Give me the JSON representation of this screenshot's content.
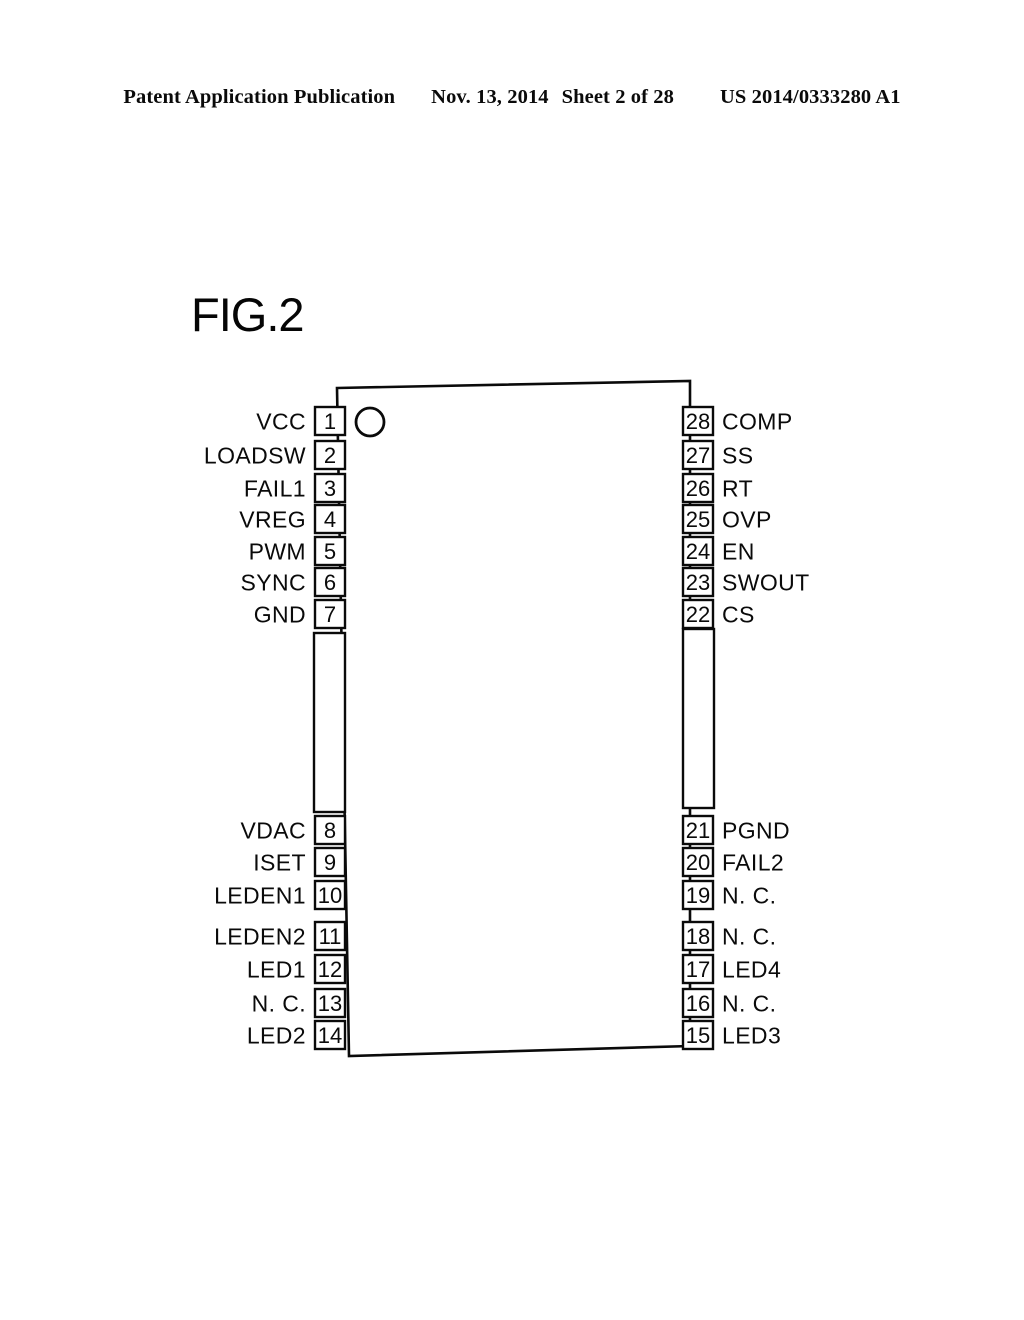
{
  "header": {
    "publication": "Patent Application Publication",
    "date": "Nov. 13, 2014",
    "sheet": "Sheet 2 of 28",
    "patent_number": "US 2014/0333280 A1"
  },
  "figure": {
    "title": "FIG.2",
    "type": "ic-pinout-diagram",
    "package": {
      "pin_count": 28,
      "orientation_marker": "circle-dot-pin1-indicator"
    },
    "colors": {
      "ink": "#0a0a0a",
      "paper": "#ffffff"
    },
    "pins_left": [
      {
        "number": "1",
        "label": "VCC"
      },
      {
        "number": "2",
        "label": "LOADSW"
      },
      {
        "number": "3",
        "label": "FAIL1"
      },
      {
        "number": "4",
        "label": "VREG"
      },
      {
        "number": "5",
        "label": "PWM"
      },
      {
        "number": "6",
        "label": "SYNC"
      },
      {
        "number": "7",
        "label": "GND"
      },
      {
        "number": "8",
        "label": "VDAC"
      },
      {
        "number": "9",
        "label": "ISET"
      },
      {
        "number": "10",
        "label": "LEDEN1"
      },
      {
        "number": "11",
        "label": "LEDEN2"
      },
      {
        "number": "12",
        "label": "LED1"
      },
      {
        "number": "13",
        "label": "N. C."
      },
      {
        "number": "14",
        "label": "LED2"
      }
    ],
    "pins_right": [
      {
        "number": "28",
        "label": "COMP"
      },
      {
        "number": "27",
        "label": "SS"
      },
      {
        "number": "26",
        "label": "RT"
      },
      {
        "number": "25",
        "label": "OVP"
      },
      {
        "number": "24",
        "label": "EN"
      },
      {
        "number": "23",
        "label": "SWOUT"
      },
      {
        "number": "22",
        "label": "CS"
      },
      {
        "number": "21",
        "label": "PGND"
      },
      {
        "number": "20",
        "label": "FAIL2"
      },
      {
        "number": "19",
        "label": "N. C."
      },
      {
        "number": "18",
        "label": "N. C."
      },
      {
        "number": "17",
        "label": "LED4"
      },
      {
        "number": "16",
        "label": "N. C."
      },
      {
        "number": "15",
        "label": "LED3"
      }
    ]
  }
}
